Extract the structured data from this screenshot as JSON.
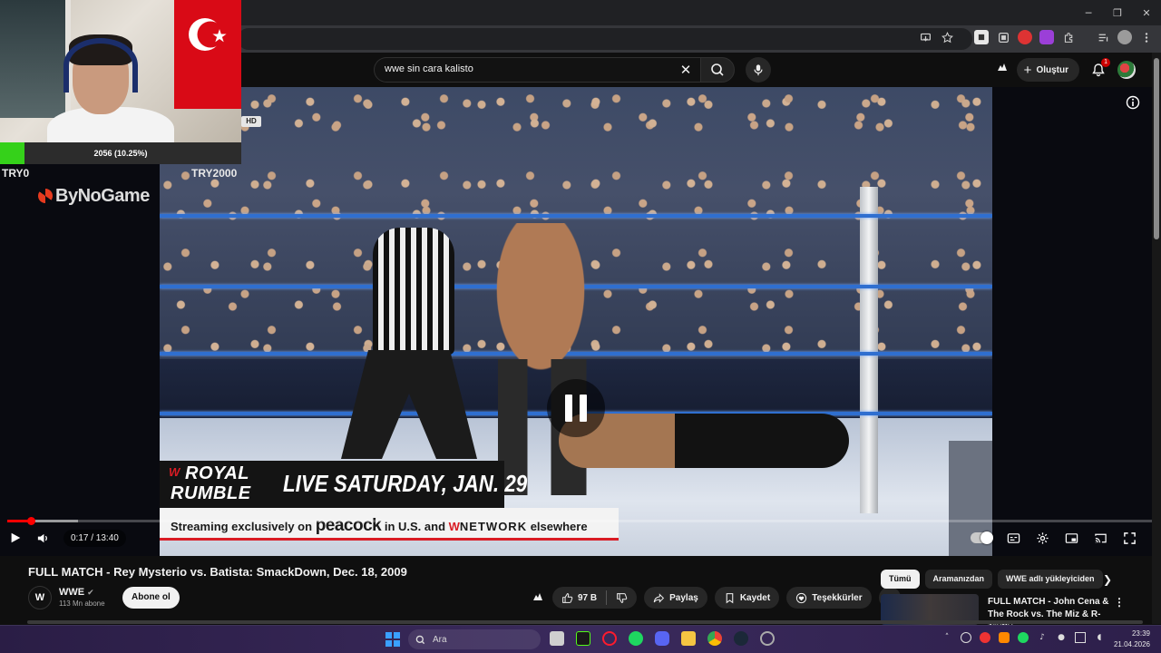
{
  "window": {
    "minimize_glyph": "─",
    "restore_glyph": "❐",
    "close_glyph": "✕"
  },
  "search": {
    "query": "wwe sin cara kalisto",
    "clear_glyph": "✕"
  },
  "masthead": {
    "create_label": "Oluştur",
    "notification_count": "1"
  },
  "player": {
    "current_time": "0:17",
    "duration": "13:40",
    "time_display": "0:17 / 13:40",
    "progress_fraction": 0.0207,
    "buffered_fraction": 0.062,
    "quality_badge": "HD",
    "state": "paused"
  },
  "video_overlay": {
    "promo_brand_line1": "ROYAL",
    "promo_brand_line2": "RUMBLE",
    "promo_w": "W",
    "promo_headline": "LIVE SATURDAY, JAN. 29",
    "stream_prefix": "Streaming exclusively on ",
    "stream_brand": "peacock",
    "stream_mid": " in U.S. and ",
    "stream_network": "NETWORK",
    "stream_suffix": " elsewhere"
  },
  "streamer_overlay": {
    "goal_text": "2056 (10.25%)",
    "goal_fraction": 0.1025,
    "goal_min": "TRY0",
    "goal_max": "TRY2000",
    "sponsor": "ByNoGame"
  },
  "video": {
    "title": "FULL MATCH - Rey Mysterio vs. Batista: SmackDown, Dec. 18, 2009",
    "channel_name": "WWE",
    "channel_avatar_text": "W",
    "verified_glyph": "✔",
    "subscribers": "113 Mn abone",
    "subscribe_label": "Abone ol",
    "likes": "97 B",
    "share_label": "Paylaş",
    "save_label": "Kaydet",
    "thanks_label": "Teşekkürler",
    "more_glyph": "⋯"
  },
  "sidebar": {
    "chips": [
      {
        "label": "Tümü",
        "active": true
      },
      {
        "label": "Aramanızdan",
        "active": false
      },
      {
        "label": "WWE adlı yükleyiciden",
        "active": false
      }
    ],
    "next_glyph": "❯",
    "recommended_title": "FULL MATCH - John Cena & The Rock vs. The Miz & R-Truth: ...",
    "recommended_menu": "⋮"
  },
  "taskbar": {
    "search_label": "Ara",
    "time": "23:39",
    "date": "21.04.2026"
  },
  "colors": {
    "youtube_red": "#ff0000",
    "goal_green": "#35d11a",
    "rope_blue": "#2f6fd0",
    "wwe_red": "#d91c24"
  }
}
